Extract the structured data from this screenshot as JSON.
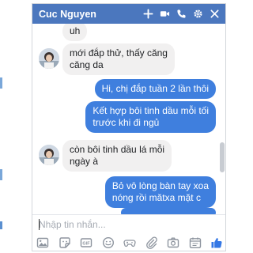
{
  "chat": {
    "title": "Cuc Nguyen",
    "header_icons": [
      "plus-icon",
      "video-camera-icon",
      "phone-icon",
      "gear-icon",
      "close-icon"
    ]
  },
  "messages": [
    {
      "direction": "in",
      "text": "uh"
    },
    {
      "direction": "in",
      "text": "mới đắp thử, thấy căng\ncăng da"
    },
    {
      "direction": "out",
      "text": "Hi, chị đắp tuần 2 lần thôi"
    },
    {
      "direction": "out",
      "text": "Kết hợp bôi tinh dầu mỗi tối\ntrước khi đi ngủ"
    },
    {
      "direction": "in",
      "text": "còn bôi tinh dầu lá mỗi\nngày à"
    },
    {
      "direction": "out",
      "text": "Bỏ vô lòng bàn tay xoa\nnóng rồi mătxa mặt c"
    }
  ],
  "composer": {
    "placeholder": "Nhập tin nhắn..."
  },
  "toolbar": [
    "photo-icon",
    "sticker-icon",
    "gif-icon",
    "emoji-icon",
    "game-icon",
    "attachment-icon",
    "camera-icon",
    "calendar-icon",
    "like-icon"
  ],
  "colors": {
    "header": "#4b77be",
    "outgoing_bubble": "#3f7fde",
    "incoming_bubble": "#f1f0f0",
    "like": "#3578e5"
  }
}
